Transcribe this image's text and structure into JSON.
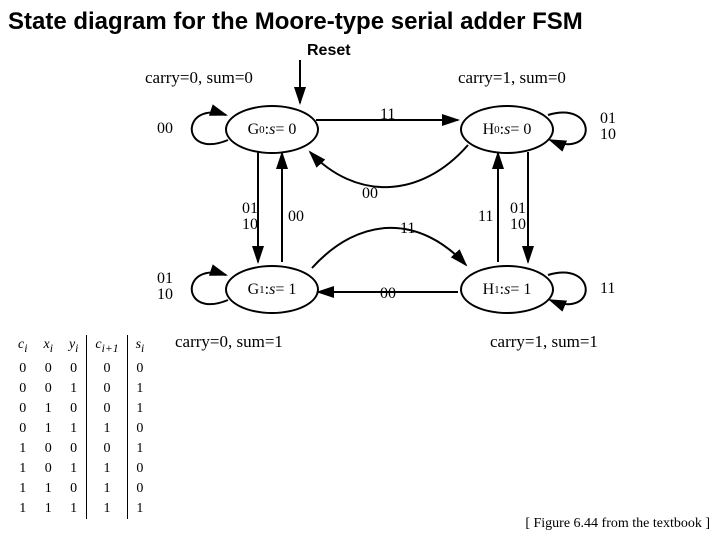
{
  "title": "State diagram for the Moore-type serial adder FSM",
  "reset": "Reset",
  "desc": {
    "g0": "carry=0, sum=0",
    "h0": "carry=1, sum=0",
    "g1": "carry=0, sum=1",
    "h1": "carry=1, sum=1"
  },
  "states": {
    "g0": "G0: s = 0",
    "h0": "H0: s = 0",
    "g1": "G1: s = 1",
    "h1": "H1: s = 1"
  },
  "edges": {
    "g0_self": "00",
    "h0_self_a": "01",
    "h0_self_b": "10",
    "g1_self_a": "01",
    "g1_self_b": "10",
    "h1_self": "11",
    "g0_h0": "11",
    "h0_g0": "00",
    "g0_g1_a": "01",
    "g0_g1_b": "10",
    "g1_g0": "00",
    "h0_h1_a": "01",
    "h0_h1_b": "10",
    "h1_h0": "11",
    "g1_h1": "11",
    "h1_g1": "00"
  },
  "truth": {
    "headers": [
      "ci",
      "xi",
      "yi",
      "ci+1",
      "si"
    ],
    "rows": [
      [
        "0",
        "0",
        "0",
        "0",
        "0"
      ],
      [
        "0",
        "0",
        "1",
        "0",
        "1"
      ],
      [
        "0",
        "1",
        "0",
        "0",
        "1"
      ],
      [
        "0",
        "1",
        "1",
        "1",
        "0"
      ],
      [
        "1",
        "0",
        "0",
        "0",
        "1"
      ],
      [
        "1",
        "0",
        "1",
        "1",
        "0"
      ],
      [
        "1",
        "1",
        "0",
        "1",
        "0"
      ],
      [
        "1",
        "1",
        "1",
        "1",
        "1"
      ]
    ]
  },
  "cite": "[ Figure 6.44 from the textbook ]"
}
